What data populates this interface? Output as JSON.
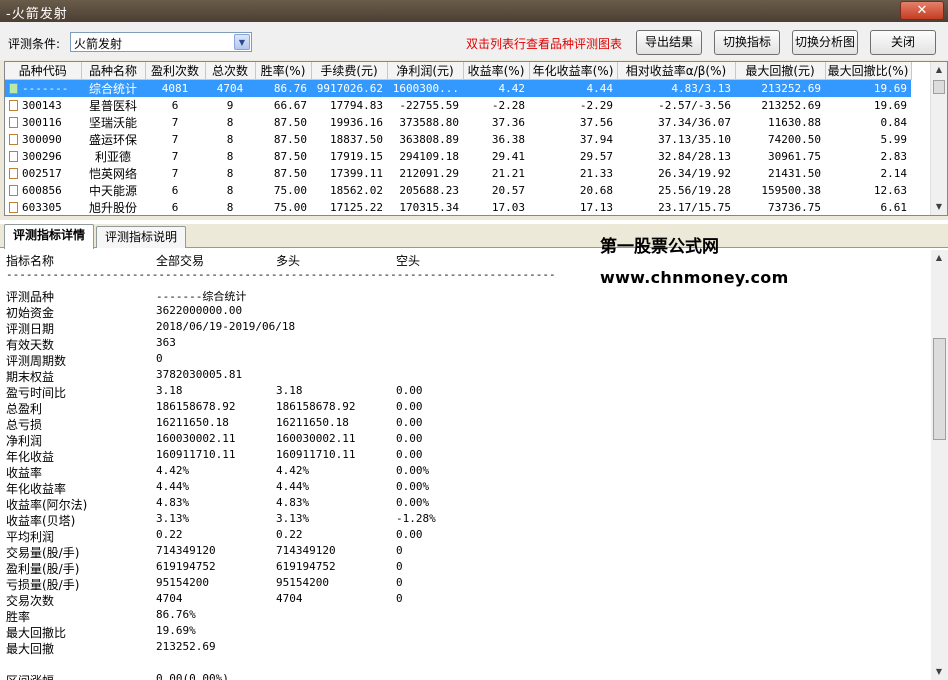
{
  "window": {
    "title": "-火箭发射",
    "close_label": "✕"
  },
  "toolbar": {
    "condition_label": "评测条件:",
    "condition_value": "火箭发射",
    "hint": "双击列表行查看品种评测图表",
    "export_label": "导出结果",
    "switch_indicator_label": "切换指标",
    "switch_chart_label": "切换分析图",
    "close_label": "关闭"
  },
  "grid": {
    "columns": [
      "品种代码",
      "品种名称",
      "盈利次数",
      "总次数",
      "胜率(%)",
      "手续费(元)",
      "净利润(元)",
      "收益率(%)",
      "年化收益率(%)",
      "相对收益率α/β(%)",
      "最大回撤(元)",
      "最大回撤比(%)"
    ],
    "rows": [
      [
        "-------",
        "综合统计",
        "4081",
        "4704",
        "86.76",
        "9917026.62",
        "1600300...",
        "4.42",
        "4.44",
        "4.83/3.13",
        "213252.69",
        "19.69"
      ],
      [
        "300143",
        "星普医科",
        "6",
        "9",
        "66.67",
        "17794.83",
        "-22755.59",
        "-2.28",
        "-2.29",
        "-2.57/-3.56",
        "213252.69",
        "19.69"
      ],
      [
        "300116",
        "坚瑞沃能",
        "7",
        "8",
        "87.50",
        "19936.16",
        "373588.80",
        "37.36",
        "37.56",
        "37.34/36.07",
        "11630.88",
        "0.84"
      ],
      [
        "300090",
        "盛运环保",
        "7",
        "8",
        "87.50",
        "18837.50",
        "363808.89",
        "36.38",
        "37.94",
        "37.13/35.10",
        "74200.50",
        "5.99"
      ],
      [
        "300296",
        "利亚德",
        "7",
        "8",
        "87.50",
        "17919.15",
        "294109.18",
        "29.41",
        "29.57",
        "32.84/28.13",
        "30961.75",
        "2.83"
      ],
      [
        "002517",
        "恺英网络",
        "7",
        "8",
        "87.50",
        "17399.11",
        "212091.29",
        "21.21",
        "21.33",
        "26.34/19.92",
        "21431.50",
        "2.14"
      ],
      [
        "600856",
        "中天能源",
        "6",
        "8",
        "75.00",
        "18562.02",
        "205688.23",
        "20.57",
        "20.68",
        "25.56/19.28",
        "159500.38",
        "12.63"
      ],
      [
        "603305",
        "旭升股份",
        "6",
        "8",
        "75.00",
        "17125.22",
        "170315.34",
        "17.03",
        "17.13",
        "23.17/15.75",
        "73736.75",
        "6.61"
      ]
    ]
  },
  "tabs": [
    "评测指标详情",
    "评测指标说明"
  ],
  "watermark": {
    "line1": "第一股票公式网",
    "line2": "www.chnmoney.com"
  },
  "detail": {
    "headers": [
      "指标名称",
      "全部交易",
      "多头",
      "空头"
    ],
    "divider": "-----------------------------------------------------------------------------------",
    "rows": [
      [
        "评测品种",
        "-------综合统计",
        "",
        ""
      ],
      [
        "初始资金",
        "3622000000.00",
        "",
        ""
      ],
      [
        "评测日期",
        "2018/06/19-2019/06/18",
        "",
        ""
      ],
      [
        "有效天数",
        "363",
        "",
        ""
      ],
      [
        "评测周期数",
        "0",
        "",
        ""
      ],
      [
        "期末权益",
        "3782030005.81",
        "",
        ""
      ],
      [
        "盈亏时间比",
        "3.18",
        "3.18",
        "0.00"
      ],
      [
        "总盈利",
        "186158678.92",
        "186158678.92",
        "0.00"
      ],
      [
        "总亏损",
        "16211650.18",
        "16211650.18",
        "0.00"
      ],
      [
        "净利润",
        "160030002.11",
        "160030002.11",
        "0.00"
      ],
      [
        "年化收益",
        "160911710.11",
        "160911710.11",
        "0.00"
      ],
      [
        "收益率",
        "4.42%",
        "4.42%",
        "0.00%"
      ],
      [
        "年化收益率",
        "4.44%",
        "4.44%",
        "0.00%"
      ],
      [
        "收益率(阿尔法)",
        "4.83%",
        "4.83%",
        "0.00%"
      ],
      [
        "收益率(贝塔)",
        "3.13%",
        "3.13%",
        "-1.28%"
      ],
      [
        "平均利润",
        "0.22",
        "0.22",
        "0.00"
      ],
      [
        "交易量(股/手)",
        "714349120",
        "714349120",
        "0"
      ],
      [
        "盈利量(股/手)",
        "619194752",
        "619194752",
        "0"
      ],
      [
        "亏损量(股/手)",
        "95154200",
        "95154200",
        "0"
      ],
      [
        "交易次数",
        "4704",
        "4704",
        "0"
      ],
      [
        "胜率",
        "86.76%",
        "",
        ""
      ],
      [
        "最大回撤比",
        "19.69%",
        "",
        ""
      ],
      [
        "最大回撤",
        "213252.69",
        "",
        ""
      ],
      [
        "",
        "",
        "",
        ""
      ],
      [
        "区间涨幅",
        "0.00(0.00%)",
        "",
        ""
      ]
    ]
  }
}
